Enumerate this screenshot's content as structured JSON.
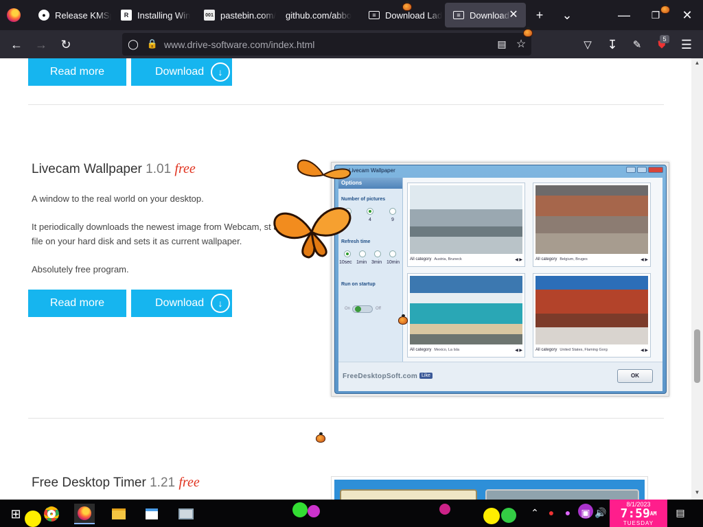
{
  "browser": {
    "tabs": [
      {
        "label": "Release KMSp",
        "icon": "github-icon"
      },
      {
        "label": "Installing Win",
        "icon": "r-icon"
      },
      {
        "label": "pastebin.com/",
        "icon": "pastebin-icon"
      },
      {
        "label": "github.com/abbo",
        "icon": "github-icon"
      },
      {
        "label": "Download Lad",
        "icon": "page-icon"
      },
      {
        "label": "Download A",
        "icon": "page-icon",
        "active": true
      }
    ],
    "url_host": "www.drive-software.com",
    "url_path": "/index.html",
    "extension_badge": "5",
    "active_tab_color": "#42414d"
  },
  "page": {
    "top_buttons": {
      "read_more": "Read more",
      "download": "Download"
    },
    "product1": {
      "name": "Livecam Wallpaper",
      "version": "1.01",
      "free": "free",
      "desc1": "A window to the real world on your desktop.",
      "desc2": "It periodically downloads the newest image from Webcam, st a file on your hard disk and sets it as current wallpaper.",
      "desc3": "Absolutely free program.",
      "read_more": "Read more",
      "download": "Download"
    },
    "app": {
      "window_title": "Livecam Wallpaper",
      "options_title": "Options",
      "num_pictures_label": "Number of pictures",
      "num_pictures": [
        "1",
        "4",
        "9"
      ],
      "refresh_label": "Refresh time",
      "refresh": [
        "10sec",
        "1min",
        "3min",
        "10min"
      ],
      "startup_label": "Run on startup",
      "toggle_on": "On",
      "toggle_off": "Off",
      "cams": [
        {
          "category": "All category",
          "location": "Austria, Bruneck"
        },
        {
          "category": "All category",
          "location": "Belgium, Bruges"
        },
        {
          "category": "All category",
          "location": "Mexico, La Isla"
        },
        {
          "category": "All category",
          "location": "United States, Flaming Gorg"
        }
      ],
      "brand": "FreeDesktopSoft.com",
      "like": "Like",
      "ok": "OK"
    },
    "product2": {
      "name": "Free Desktop Timer",
      "version": "1.21",
      "free": "free"
    },
    "accent_color": "#16b5ef",
    "free_color": "#e0321e"
  },
  "taskbar": {
    "clock_date": "8/1/2023",
    "clock_time": "7:59",
    "clock_ampm": "AM",
    "clock_day": "TUESDAY"
  }
}
